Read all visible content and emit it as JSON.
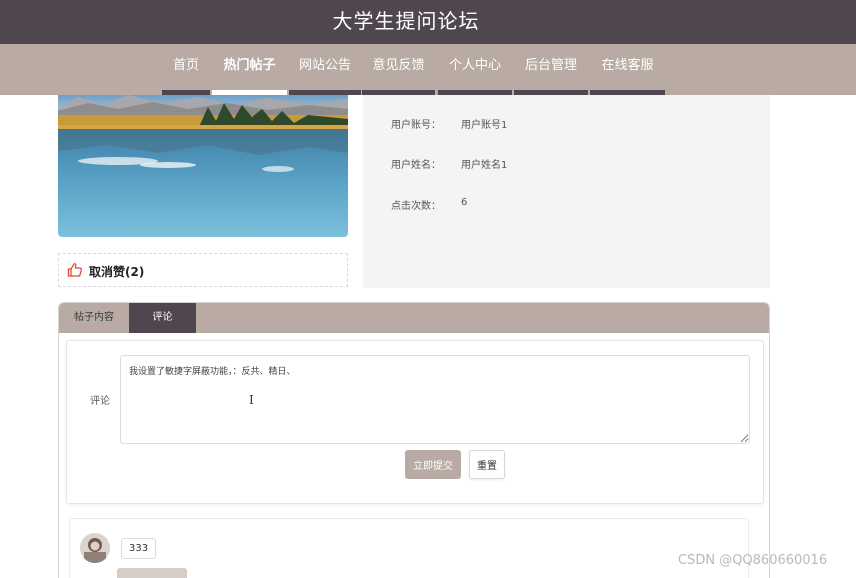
{
  "header": {
    "title": "大学生提问论坛"
  },
  "nav": {
    "items": [
      {
        "label": "首页"
      },
      {
        "label": "热门帖子"
      },
      {
        "label": "网站公告"
      },
      {
        "label": "意见反馈"
      },
      {
        "label": "个人中心"
      },
      {
        "label": "后台管理"
      },
      {
        "label": "在线客服"
      }
    ],
    "active_index": 1
  },
  "post": {
    "like_label": "取消赞(2)",
    "info": [
      {
        "label": "用户账号：",
        "value": "用户账号1"
      },
      {
        "label": "用户姓名：",
        "value": "用户姓名1"
      },
      {
        "label": "点击次数：",
        "value": "6"
      }
    ]
  },
  "tabs": [
    {
      "label": "帖子内容"
    },
    {
      "label": "评论"
    }
  ],
  "comment_form": {
    "label": "评论",
    "textarea_value": "我设置了敏捷字屏蔽功能，：反共、精日、",
    "submit_label": "立即提交",
    "reset_label": "重置"
  },
  "comments": [
    {
      "text": "333"
    }
  ],
  "watermark": "CSDN @QQ860660016",
  "colors": {
    "header_bg": "#4f4650",
    "nav_bg": "#b9aba4",
    "accent": "#b9aba4",
    "like_icon": "#e04b3a"
  }
}
